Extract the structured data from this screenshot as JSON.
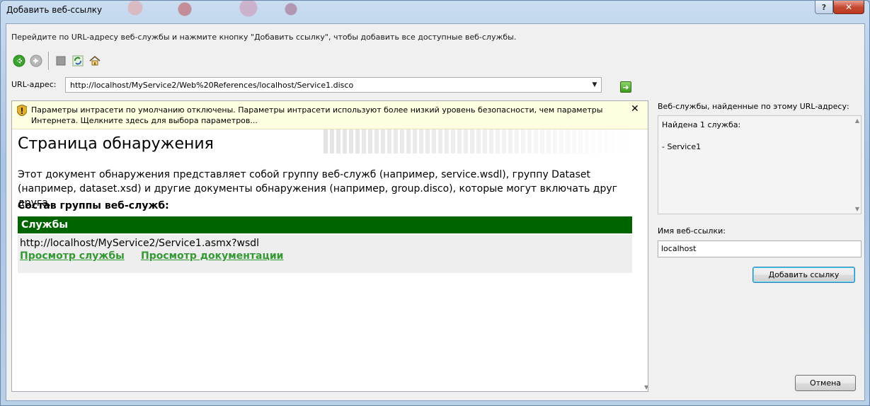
{
  "window": {
    "title": "Добавить веб-ссылку",
    "help_label": "?",
    "close_label": "✕"
  },
  "instruction": "Перейдите по URL-адресу веб-службы и нажмите кнопку \"Добавить ссылку\", чтобы добавить все доступные веб-службы.",
  "toolbar": {
    "back_icon": "back-arrow-icon",
    "forward_icon": "forward-arrow-icon",
    "stop_icon": "stop-icon",
    "refresh_icon": "refresh-icon",
    "home_icon": "home-icon"
  },
  "url": {
    "label": "URL-адрес:",
    "value": "http://localhost/MyService2/Web%20References/localhost/Service1.disco",
    "dropdown_glyph": "▼",
    "go_glyph": "➜"
  },
  "infobar": {
    "text": "Параметры интрасети по умолчанию отключены. Параметры интрасети используют более низкий уровень безопасности, чем параметры Интернета. Щелкните здесь для выбора параметров...",
    "close_label": "✕"
  },
  "page": {
    "title": "Страница обнаружения",
    "description": "Этот документ обнаружения представляет собой группу веб-служб (например, service.wsdl), группу Dataset (например, dataset.xsd) и другие документы обнаружения (например, group.disco), которые могут включать друг друга.",
    "group_title": "Состав группы веб-служб:",
    "services_header": "Службы",
    "service_url": "http://localhost/MyService2/Service1.asmx?wsdl",
    "view_service_link": "Просмотр службы",
    "view_docs_link": "Просмотр документации",
    "scroll_glyph": "▼"
  },
  "right_panel": {
    "found_label": "Веб-службы, найденные по этому URL-адресу:",
    "found_line1": "Найдена 1 служба:",
    "found_line2": "- Service1",
    "scroll_up_glyph": "▲",
    "scroll_down_glyph": "▼",
    "name_label": "Имя веб-ссылки:",
    "name_value": "localhost",
    "add_button": "Добавить ссылку",
    "cancel_button": "Отмена"
  },
  "colors": {
    "services_header_bg": "#006400",
    "link_color": "#339933",
    "infobar_bg": "#ffffe1",
    "close_button": "#c74b34"
  }
}
